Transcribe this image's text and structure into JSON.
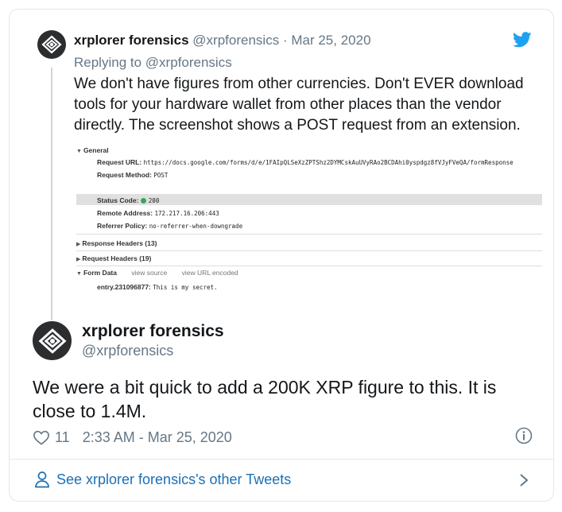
{
  "parent_tweet": {
    "name": "xrplorer forensics",
    "handle": "@xrpforensics",
    "separator": "·",
    "date": "Mar 25, 2020",
    "replying_prefix": "Replying to",
    "replying_to": "@xrpforensics",
    "text": "We don't have figures from other currencies. Don't EVER download tools for your hardware wallet from other places than the vendor directly. The screenshot shows a POST request from an extension.",
    "icon": "twitter-bird-icon",
    "brand_color": "#1da1f2"
  },
  "devtools": {
    "general": "General",
    "request_url_label": "Request URL:",
    "request_url": "https://docs.google.com/forms/d/e/1FAIpQLSeXzZPTShz2DYMCskAuUVyRAo2BCDAhi0yspdgz8fVJyFVeQA/formResponse",
    "method_label": "Request Method:",
    "method": "POST",
    "status_label": "Status Code:",
    "status": "200",
    "remote_label": "Remote Address:",
    "remote": "172.217.16.206:443",
    "referrer_label": "Referrer Policy:",
    "referrer": "no-referrer-when-downgrade",
    "response_headers": "Response Headers (13)",
    "request_headers": "Request Headers (19)",
    "form_data": "Form Data",
    "view_source": "view source",
    "view_url_encoded": "view URL encoded",
    "entry_label": "entry.231096877:",
    "entry_value": "This is my secret."
  },
  "main_tweet": {
    "name": "xrplorer forensics",
    "handle": "@xrpforensics",
    "text": "We were a bit quick to add a 200K XRP figure to this. It is close to 1.4M.",
    "likes": "11",
    "timestamp": "2:33 AM - Mar 25, 2020"
  },
  "footer": {
    "link_text": "See xrplorer forensics's other Tweets",
    "link_color": "#1b6fb5"
  }
}
